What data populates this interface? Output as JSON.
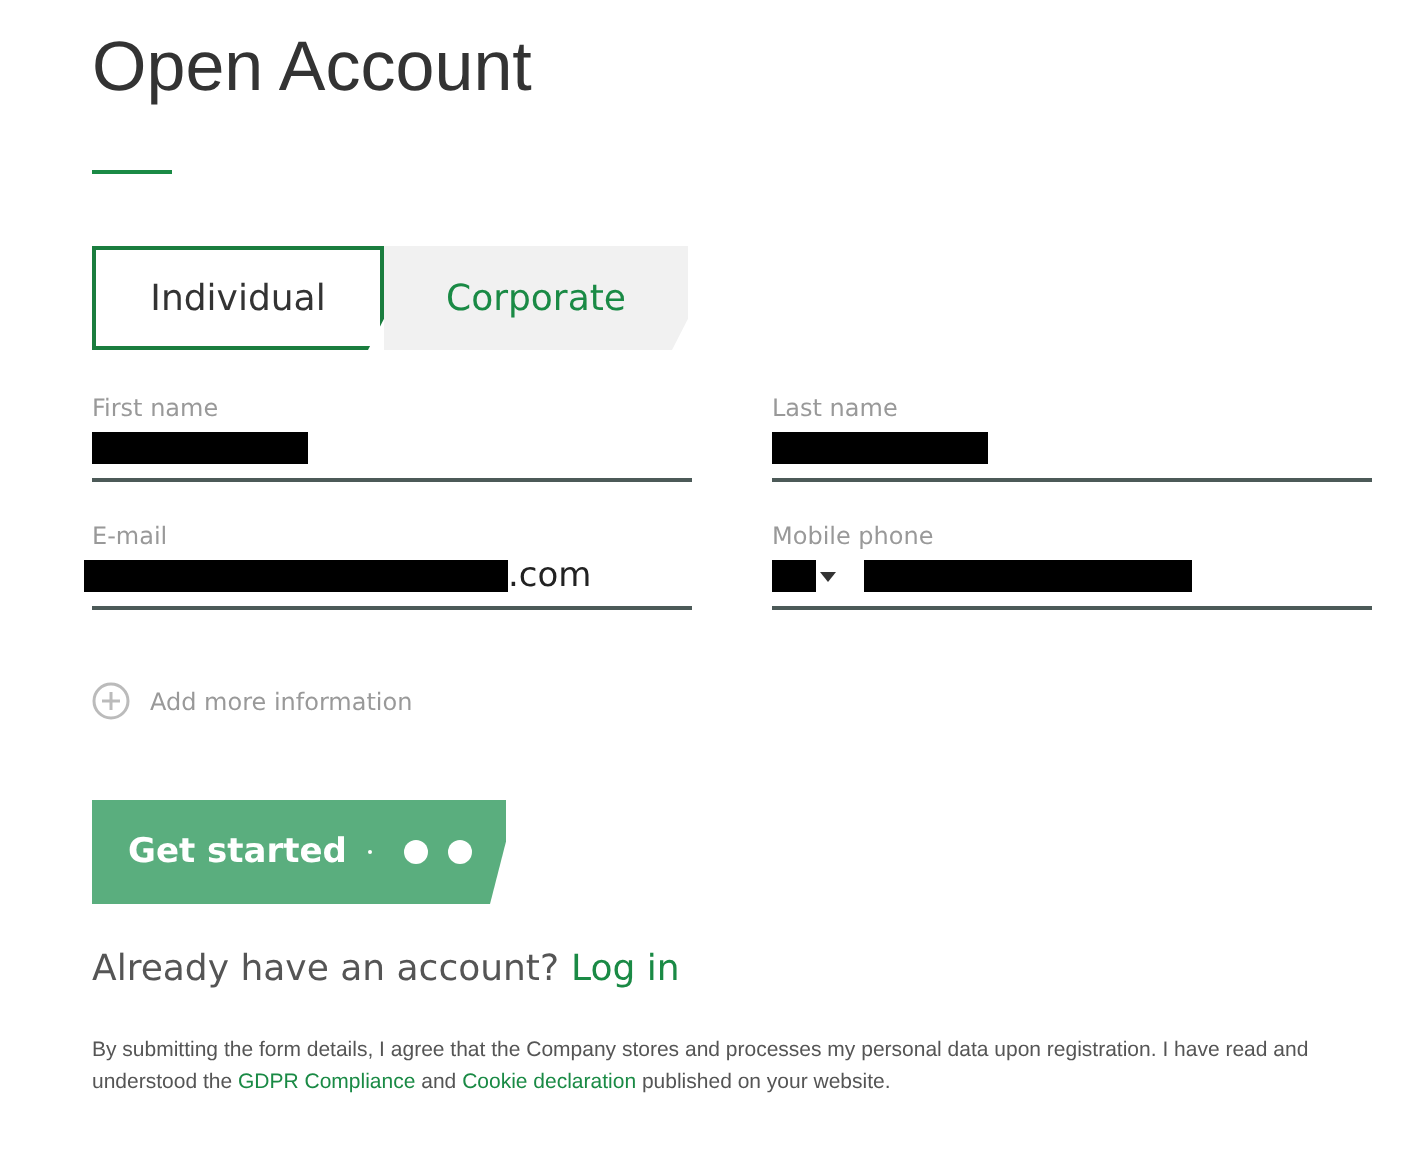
{
  "title": "Open Account",
  "tabs": [
    {
      "label": "Individual",
      "selected": true
    },
    {
      "label": "Corporate",
      "selected": false
    }
  ],
  "fields": [
    {
      "label": "First name",
      "kind": "text",
      "redacted": true
    },
    {
      "label": "Last name",
      "kind": "text",
      "redacted": true
    },
    {
      "label": "E-mail",
      "kind": "text",
      "redacted": true,
      "value": ".com"
    },
    {
      "label": "Mobile phone",
      "kind": "phone",
      "redacted": true
    }
  ],
  "add_more": "Add more information",
  "submit": {
    "label": "Get started",
    "loading": true
  },
  "login_prompt": {
    "text": "Already have an account?",
    "link": "Log in"
  },
  "consent": {
    "before": "By submitting the form details, I agree that the Company stores and processes my personal data upon registration. I have read and understood the",
    "link_1": "GDPR Compliance",
    "middle": "and",
    "link_2": "Cookie declaration",
    "after": "published on your website."
  }
}
